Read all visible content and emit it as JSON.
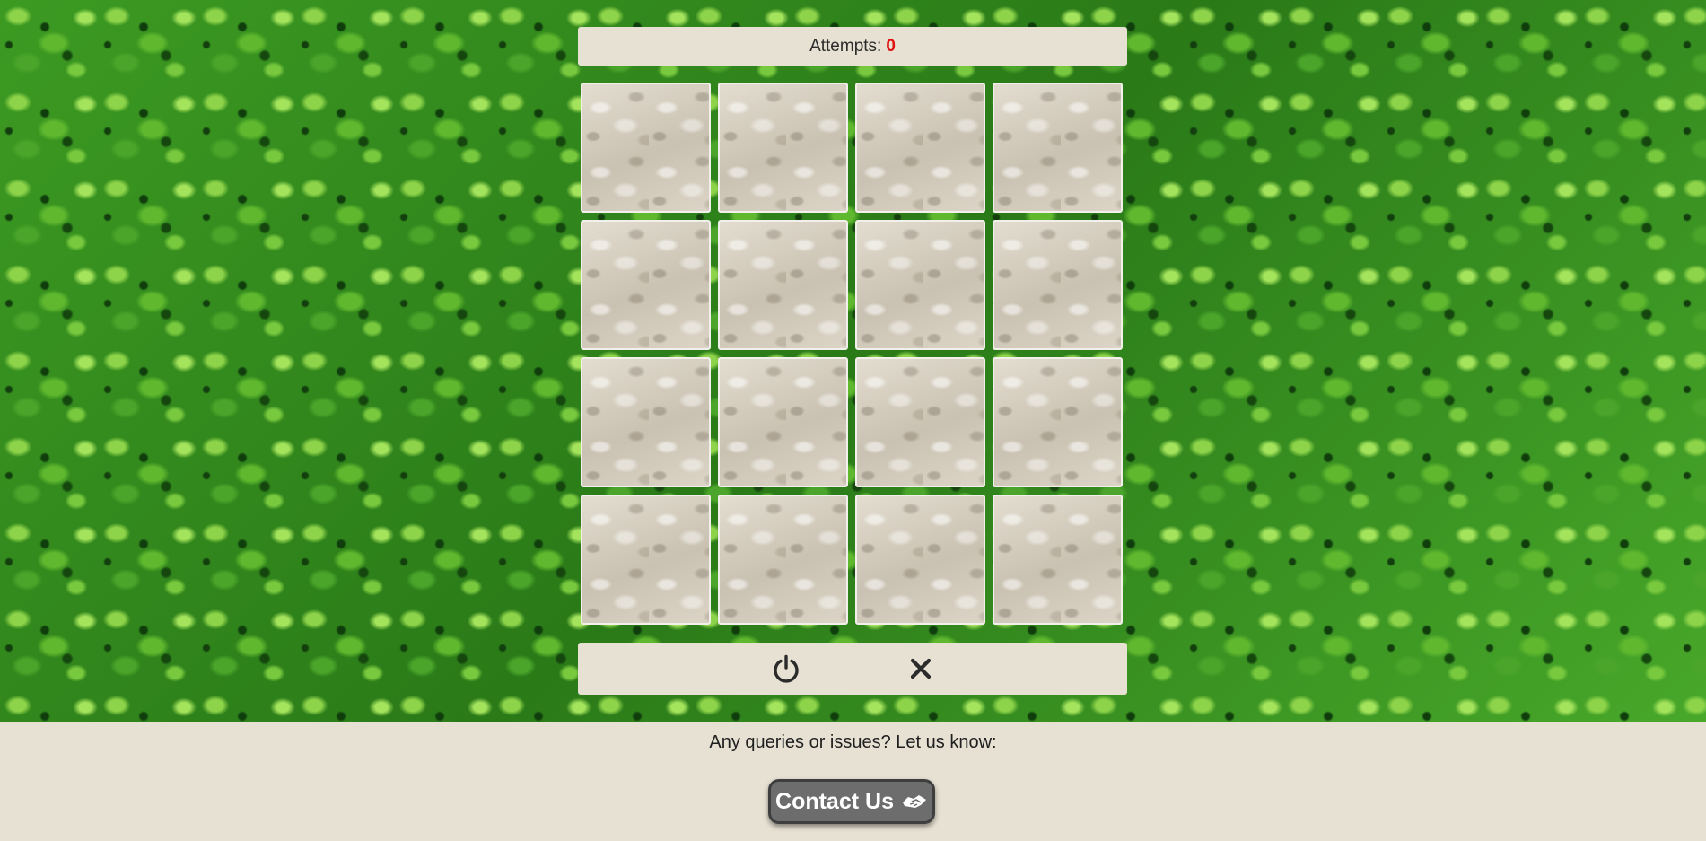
{
  "header": {
    "attempts_label": "Attempts:",
    "attempts_count": "0",
    "attempts_color": "#e01010"
  },
  "board": {
    "rows": 4,
    "columns": 4,
    "cards": [
      {
        "state": "face-down"
      },
      {
        "state": "face-down"
      },
      {
        "state": "face-down"
      },
      {
        "state": "face-down"
      },
      {
        "state": "face-down"
      },
      {
        "state": "face-down"
      },
      {
        "state": "face-down"
      },
      {
        "state": "face-down"
      },
      {
        "state": "face-down"
      },
      {
        "state": "face-down"
      },
      {
        "state": "face-down"
      },
      {
        "state": "face-down"
      },
      {
        "state": "face-down"
      },
      {
        "state": "face-down"
      },
      {
        "state": "face-down"
      },
      {
        "state": "face-down"
      }
    ]
  },
  "controls": {
    "power_icon": "power-icon",
    "close_icon": "close-icon"
  },
  "footer": {
    "prompt": "Any queries or issues? Let us know:",
    "contact_label": "Contact Us",
    "contact_icon": "handshake-icon"
  },
  "colors": {
    "panel_bg": "#e6e1d3",
    "button_bg": "#6d6d6d",
    "background_leaves": "#2f8a1e"
  }
}
